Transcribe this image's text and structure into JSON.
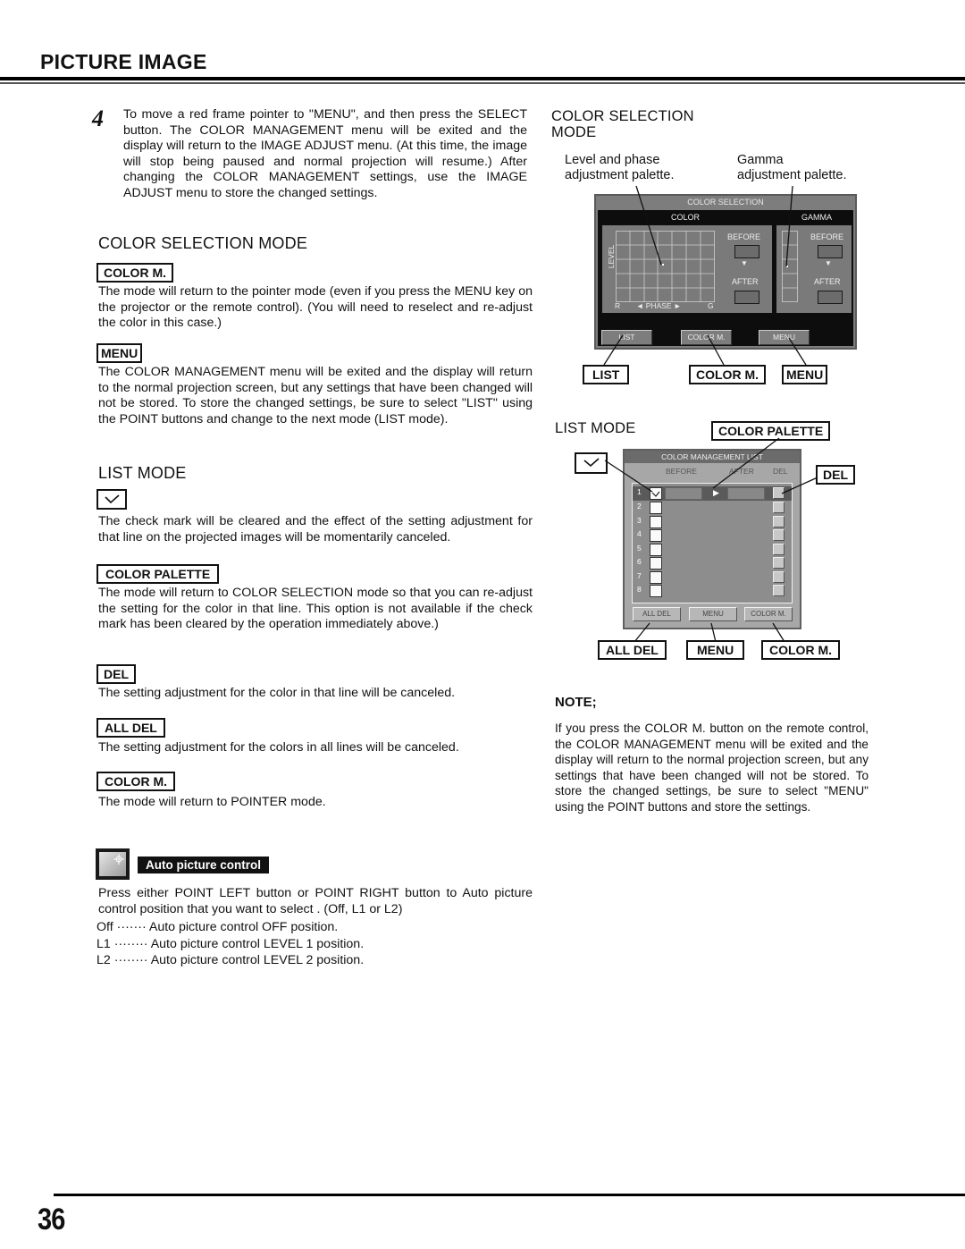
{
  "header": {
    "title": "PICTURE IMAGE"
  },
  "step4": {
    "number": "4",
    "text": "To move a red frame pointer to \"MENU\", and then press the SELECT button. The COLOR MANAGEMENT menu will be exited and the display will return to the IMAGE ADJUST menu. (At this time, the image will stop being paused and normal projection will resume.) After changing the COLOR MANAGEMENT settings, use the IMAGE ADJUST menu to store the changed settings."
  },
  "color_selection_mode": {
    "heading": "COLOR SELECTION MODE",
    "items": [
      {
        "key": "COLOR M.",
        "text": "The mode will return to the pointer mode (even if you press the MENU key on the projector or the remote control). (You will need to reselect and re-adjust the color in this case.)"
      },
      {
        "key": "MENU",
        "text": "The COLOR MANAGEMENT menu will be exited and the display will return to the normal projection screen, but any settings that have been changed will not be stored. To store the changed settings, be sure to select \"LIST\" using the POINT buttons and change to the next mode (LIST mode)."
      }
    ]
  },
  "list_mode": {
    "heading": "LIST MODE",
    "items": [
      {
        "key": "check-mark",
        "text": "The check mark will be cleared and the effect of the setting adjustment for that line on the projected images will be momentarily canceled."
      },
      {
        "key": "COLOR PALETTE",
        "text": "The mode will return to COLOR SELECTION mode so that you can re-adjust the setting for the color in that line. This option is not available if the check mark has been cleared by the operation immediately above.)"
      },
      {
        "key": "DEL",
        "text": "The setting adjustment for the color in that line will be canceled."
      },
      {
        "key": "ALL DEL",
        "text": "The setting adjustment for the colors in all lines will be canceled."
      },
      {
        "key": "COLOR M.",
        "text": "The mode will return to POINTER mode."
      }
    ]
  },
  "auto_picture": {
    "icon": "auto-picture-icon",
    "label": "Auto picture control",
    "text": "Press either POINT LEFT button or POINT RIGHT button to Auto picture control position that you want to select . (Off, L1 or L2)",
    "options": [
      {
        "key": "Off",
        "dots": "·······",
        "desc": "Auto picture control OFF position."
      },
      {
        "key": "L1",
        "dots": "········",
        "desc": "Auto picture control LEVEL 1 position."
      },
      {
        "key": "L2",
        "dots": "········",
        "desc": "Auto picture control LEVEL 2 position."
      }
    ]
  },
  "diagram_color_selection": {
    "heading_line1": "COLOR SELECTION",
    "heading_line2": "MODE",
    "callout_left_1": "Level and phase",
    "callout_left_2": "adjustment palette.",
    "callout_right_1": "Gamma",
    "callout_right_2": "adjustment palette.",
    "screen": {
      "title": "COLOR SELECTION",
      "color_label": "COLOR",
      "gamma_label": "GAMMA",
      "level_label": "LEVEL",
      "phase_label": "◄ PHASE ►",
      "r_label": "R",
      "g_label": "G",
      "before": "BEFORE",
      "after": "AFTER",
      "arrow": "▼",
      "buttons": [
        "LIST",
        "COLOR M.",
        "MENU"
      ]
    },
    "keys": [
      "LIST",
      "COLOR M.",
      "MENU"
    ]
  },
  "diagram_list_mode": {
    "heading": "LIST MODE",
    "key_color_palette": "COLOR PALETTE",
    "key_del": "DEL",
    "screen": {
      "title": "COLOR MANAGEMENT LIST",
      "col_before": "BEFORE",
      "col_after": "AFTER",
      "col_del": "DEL",
      "rows": [
        "1",
        "2",
        "3",
        "4",
        "5",
        "6",
        "7",
        "8"
      ],
      "checked_row": "1",
      "buttons": [
        "ALL DEL",
        "MENU",
        "COLOR M."
      ]
    },
    "keys": [
      "ALL DEL",
      "MENU",
      "COLOR M."
    ]
  },
  "note": {
    "heading": "NOTE;",
    "text": "If you press the COLOR M. button on the remote control, the COLOR MANAGEMENT menu will be exited and the display will return to the normal projection screen, but any settings that have been changed will not be stored. To store the changed settings, be sure to select \"MENU\" using the POINT buttons and store the settings."
  },
  "footer": {
    "page_number": "36"
  }
}
